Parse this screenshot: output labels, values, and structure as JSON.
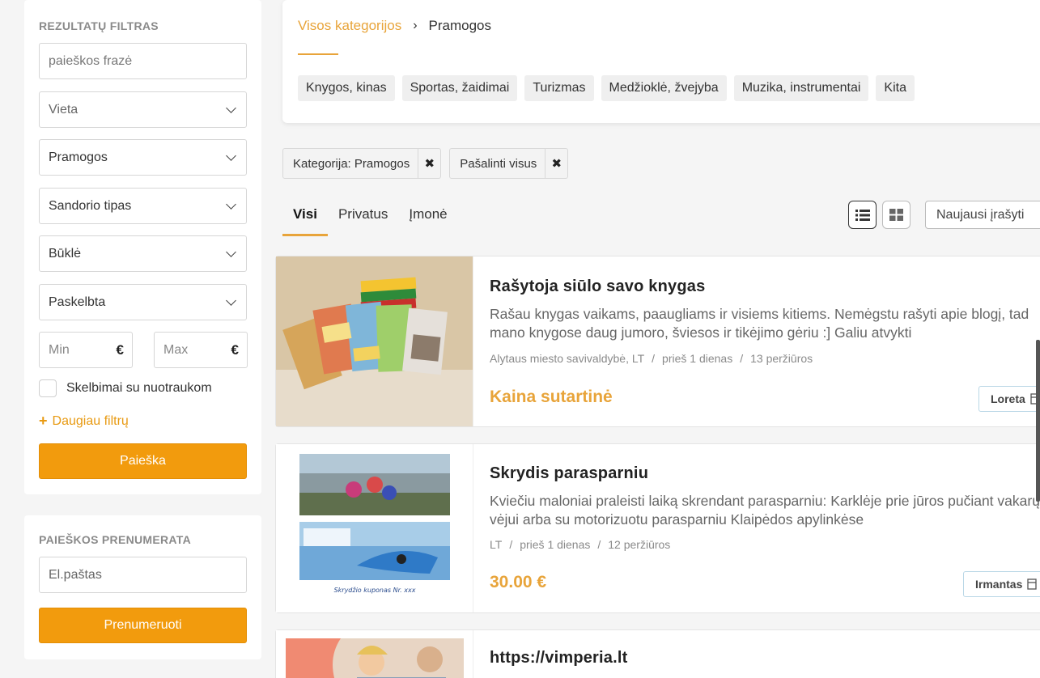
{
  "filter": {
    "title": "REZULTATŲ FILTRAS",
    "search_placeholder": "paieškos frazė",
    "location": "Vieta",
    "category": "Pramogos",
    "deal_type": "Sandorio tipas",
    "condition": "Būklė",
    "published": "Paskelbta",
    "min_placeholder": "Min",
    "max_placeholder": "Max",
    "currency": "€",
    "with_photos_label": "Skelbimai su nuotraukom",
    "more_filters_icon": "+",
    "more_filters_label": "Daugiau filtrų",
    "search_button": "Paieška"
  },
  "subscription": {
    "title": "PAIEŠKOS PRENUMERATA",
    "email_placeholder": "El.paštas",
    "subscribe_button": "Prenumeruoti"
  },
  "breadcrumb": {
    "root": "Visos kategorijos",
    "separator": "›",
    "current": "Pramogos"
  },
  "subcategories": [
    "Knygos, kinas",
    "Sportas, žaidimai",
    "Turizmas",
    "Medžioklė, žvejyba",
    "Muzika, instrumentai",
    "Kita"
  ],
  "active_filters": {
    "category_chip": "Kategorija: Pramogos",
    "remove_all_chip": "Pašalinti visus",
    "remove_icon": "✖"
  },
  "tabs": [
    "Visi",
    "Privatus",
    "Įmonė"
  ],
  "sort": {
    "selected": "Naujausi įrašyti"
  },
  "listings": [
    {
      "title": "Rašytoja siūlo savo knygas",
      "description": "Rašau knygas vaikams, paaugliams ir visiems kitiems. Nemėgstu rašyti apie blogį, tad mano knygose daug jumoro, šviesos ir tikėjimo gėriu :] Galiu atvykti",
      "location": "Alytaus miesto savivaldybė, LT",
      "posted": "prieš 1 dienas",
      "views": "13 peržiūros",
      "price": "Kaina sutartinė",
      "seller": "Loreta"
    },
    {
      "title": "Skrydis parasparniu",
      "description": "Kviečiu maloniai praleisti laiką skrendant parasparniu: Karklėje prie jūros pučiant vakarų vėjui arba su motorizuotu parasparniu Klaipėdos apylinkėse",
      "location": "LT",
      "posted": "prieš 1 dienas",
      "views": "12 peržiūros",
      "price": "30.00 €",
      "seller": "Irmantas",
      "thumb_caption": "Skrydžio kuponas Nr. xxx"
    },
    {
      "title": "https://vimperia.lt"
    }
  ],
  "meta_separator": "/",
  "colors": {
    "accent": "#e8a43a",
    "button": "#f29b0d"
  }
}
